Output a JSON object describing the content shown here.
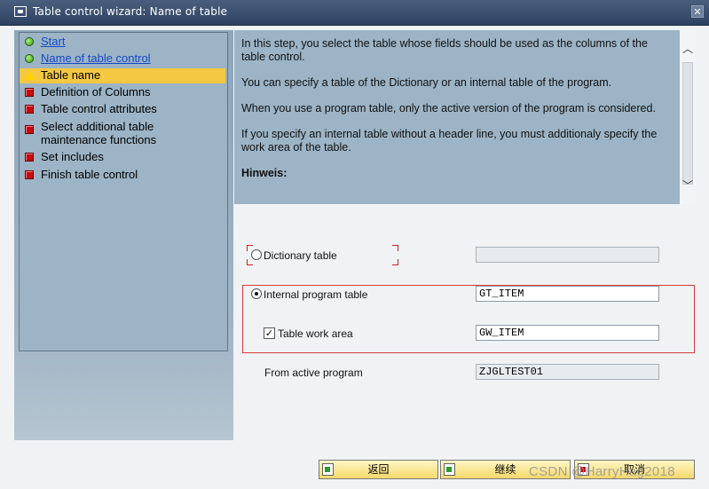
{
  "window": {
    "title": "Table control wizard: Name of table",
    "close_glyph": "✕"
  },
  "nav": {
    "items": [
      {
        "label": "Start",
        "icon": "green-dot-icon",
        "link": true
      },
      {
        "label": "Name of table control",
        "icon": "green-dot-icon",
        "link": true
      },
      {
        "label": "Table name",
        "icon": "warning-triangle-icon",
        "current": true
      },
      {
        "label": "Definition of Columns",
        "icon": "red-square-icon"
      },
      {
        "label": "Table control attributes",
        "icon": "red-square-icon"
      },
      {
        "label": "Select additional table maintenance functions",
        "icon": "red-square-icon"
      },
      {
        "label": "Set includes",
        "icon": "red-square-icon"
      },
      {
        "label": "Finish table control",
        "icon": "red-square-icon"
      }
    ]
  },
  "help": {
    "p1": "In this step, you select the table whose fields should be used as the columns of the table control.",
    "p2": "You can specify a table of the Dictionary or an internal table of the program.",
    "p3": "When you use a program table, only the active version of the program is considered.",
    "p4": "If you specify an internal table without a header line, you must additionaly specify the work area of the table.",
    "p5": "Hinweis:"
  },
  "form": {
    "dictionary_table": {
      "label": "Dictionary table",
      "value": "",
      "selected": false
    },
    "internal_program_table": {
      "label": "Internal program table",
      "value": "GT_ITEM",
      "selected": true
    },
    "table_work_area": {
      "label": "Table work area",
      "value": "GW_ITEM",
      "checked": true
    },
    "from_active_program": {
      "label": "From active program",
      "value": "ZJGLTEST01"
    }
  },
  "buttons": {
    "back": "返回",
    "continue": "继续",
    "cancel": "取消"
  },
  "watermark": "CSDN @HarryHag2018",
  "colors": {
    "title_bar": "#2d4262",
    "panel": "#9cb4c6",
    "highlight": "#f4c842",
    "link": "#1548c7",
    "error_box": "#d93a3a"
  }
}
